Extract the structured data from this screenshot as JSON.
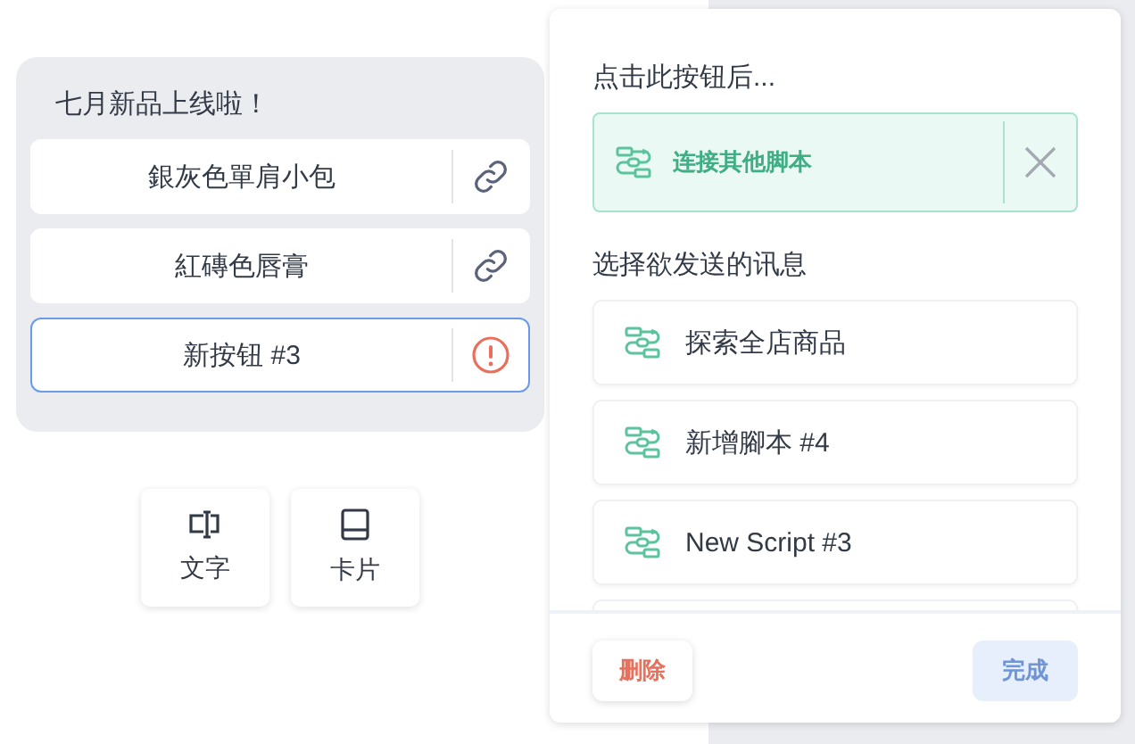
{
  "card": {
    "title": "七月新品上线啦！",
    "buttons": [
      {
        "label": "銀灰色單肩小包",
        "kind": "link",
        "selected": false
      },
      {
        "label": "紅磚色唇膏",
        "kind": "link",
        "selected": false
      },
      {
        "label": "新按钮 #3",
        "kind": "warning",
        "selected": true
      }
    ]
  },
  "add_buttons": [
    {
      "label": "文字",
      "kind": "text"
    },
    {
      "label": "卡片",
      "kind": "card"
    }
  ],
  "panel": {
    "action_label": "点击此按钮后...",
    "action": {
      "label": "连接其他脚本"
    },
    "message_label": "选择欲发送的讯息",
    "messages": [
      {
        "kind": "script",
        "label": "探索全店商品"
      },
      {
        "kind": "script",
        "label": "新增腳本 #4"
      },
      {
        "kind": "script",
        "label": "New Script #3"
      },
      {
        "kind": "hidden"
      }
    ],
    "delete_button": "删除",
    "done_button": {
      "label": "完成",
      "disabled": true
    }
  }
}
